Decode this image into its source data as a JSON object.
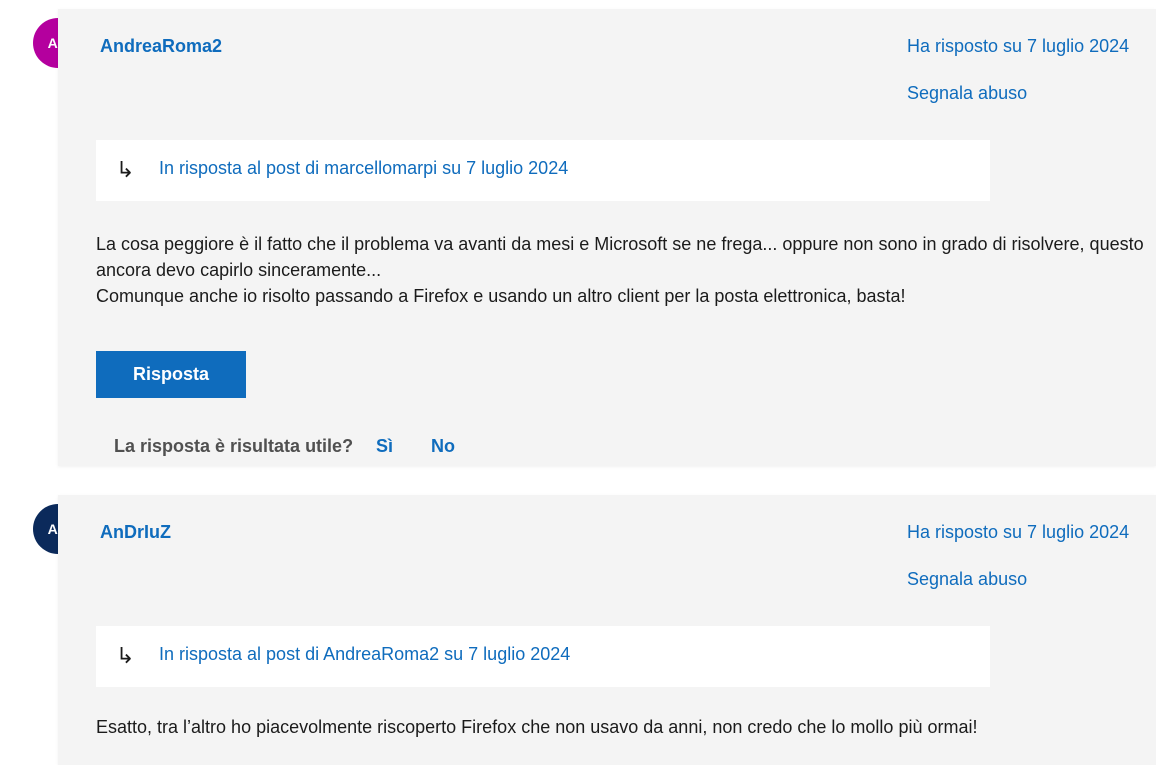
{
  "posts": [
    {
      "avatar_initials": "AN",
      "avatar_color": "#b4009e",
      "author": "AndreaRoma2",
      "replied_on": "Ha risposto su 7 luglio 2024",
      "report_label": "Segnala abuso",
      "quote_icon": "reply-arrow-icon",
      "quote_text": "In risposta al post di marcellomarpi su 7 luglio 2024",
      "body_lines": [
        "La cosa peggiore è il fatto che il problema va avanti da mesi e Microsoft se ne frega... oppure non sono in grado di risolvere, questo ancora devo capirlo sinceramente...",
        "Comunque anche io risolto passando a Firefox e usando un altro client per la posta elettronica, basta!"
      ],
      "reply_button": "Risposta",
      "helpful_question": "La risposta è risultata utile?",
      "vote_yes": "Sì",
      "vote_no": "No"
    },
    {
      "avatar_initials": "AN",
      "avatar_color": "#0b2a5b",
      "author": "AnDrIuZ",
      "replied_on": "Ha risposto su 7 luglio 2024",
      "report_label": "Segnala abuso",
      "quote_icon": "reply-arrow-icon",
      "quote_text": "In risposta al post di AndreaRoma2 su 7 luglio 2024",
      "body_lines": [
        "Esatto, tra l’altro ho piacevolmente riscoperto Firefox che non usavo da anni, non credo che lo mollo più ormai!"
      ]
    }
  ],
  "colors": {
    "link": "#0f6cbd",
    "post_background": "#f4f4f4",
    "button": "#0f6cbd"
  }
}
